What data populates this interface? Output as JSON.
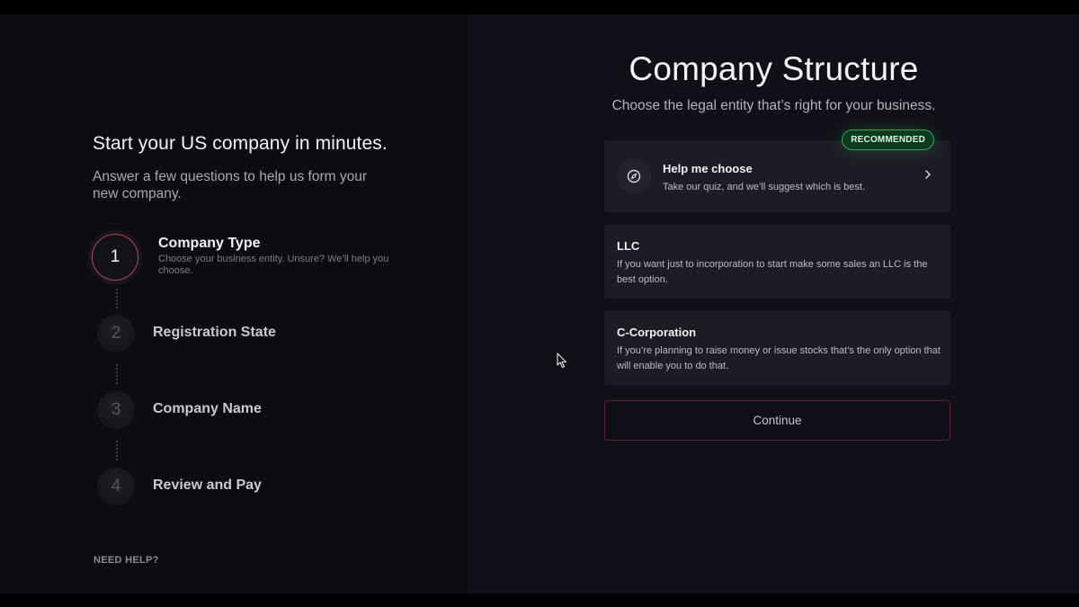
{
  "left": {
    "title": "Start your US company in minutes.",
    "subtitle": "Answer a few questions to help us form your new company.",
    "steps": [
      {
        "number": "1",
        "title": "Company Type",
        "desc": "Choose your business entity. Unsure? We’ll help you choose."
      },
      {
        "number": "2",
        "title": "Registration State"
      },
      {
        "number": "3",
        "title": "Company Name"
      },
      {
        "number": "4",
        "title": "Review and Pay"
      }
    ],
    "need_help": "NEED HELP?"
  },
  "main": {
    "title": "Company Structure",
    "subtitle": "Choose the legal entity that’s right for your business.",
    "help_card": {
      "badge": "RECOMMENDED",
      "title": "Help me choose",
      "desc": "Take our quiz, and we’ll suggest which is best.",
      "icon": "compass-icon"
    },
    "options": [
      {
        "title": "LLC",
        "desc": "If you want just to incorporation to start make some sales an LLC is the best option."
      },
      {
        "title": "C-Corporation",
        "desc": "If you’re planning to raise money or issue stocks that’s the only option that will enable you to do that."
      }
    ],
    "continue_label": "Continue"
  },
  "colors": {
    "active_step_ring": "#c0414f",
    "badge_green": "#2fa85a",
    "continue_border": "#5a2232"
  }
}
